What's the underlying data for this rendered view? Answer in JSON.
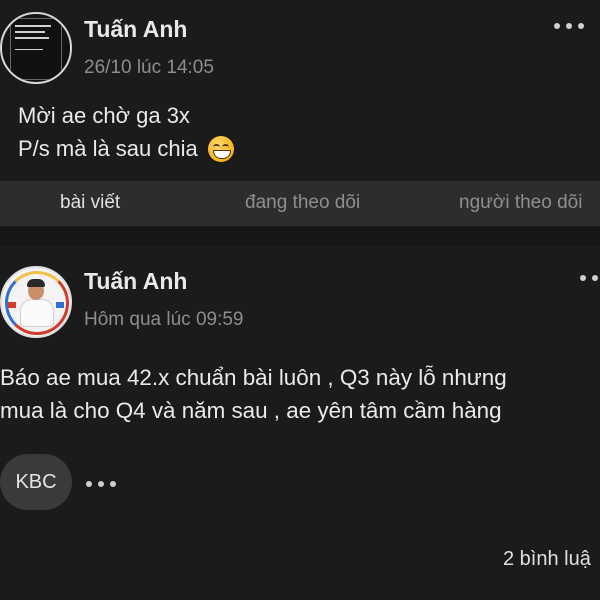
{
  "post1": {
    "author": "Tuấn Anh",
    "timestamp": "26/10 lúc 14:05",
    "line1": "Mời ae chờ ga 3x",
    "line2": "P/s mà là sau chia",
    "emoji": "grinning-face-emoji",
    "avatar_icon": "book-cover-avatar",
    "more_icon": "more-options-icon"
  },
  "tabs": {
    "posts": "bài viết",
    "following": "đang theo dõi",
    "followers": "người theo dõi"
  },
  "post2": {
    "author": "Tuấn Anh",
    "timestamp": "Hôm qua lúc 09:59",
    "line1": "Báo ae mua 42.x chuẩn bài luôn , Q3 này lỗ nhưng",
    "line2": "mua là cho Q4 và năm sau , ae yên tâm cầm hàng",
    "tag": "KBC",
    "comments": "2 bình luậ",
    "avatar_icon": "person-avatar",
    "more_icon": "more-options-icon"
  },
  "colors": {
    "background": "#1b1b1b",
    "tabbar": "#2d2d2d",
    "text": "#e6e6e6",
    "muted": "#8d8d8d"
  }
}
